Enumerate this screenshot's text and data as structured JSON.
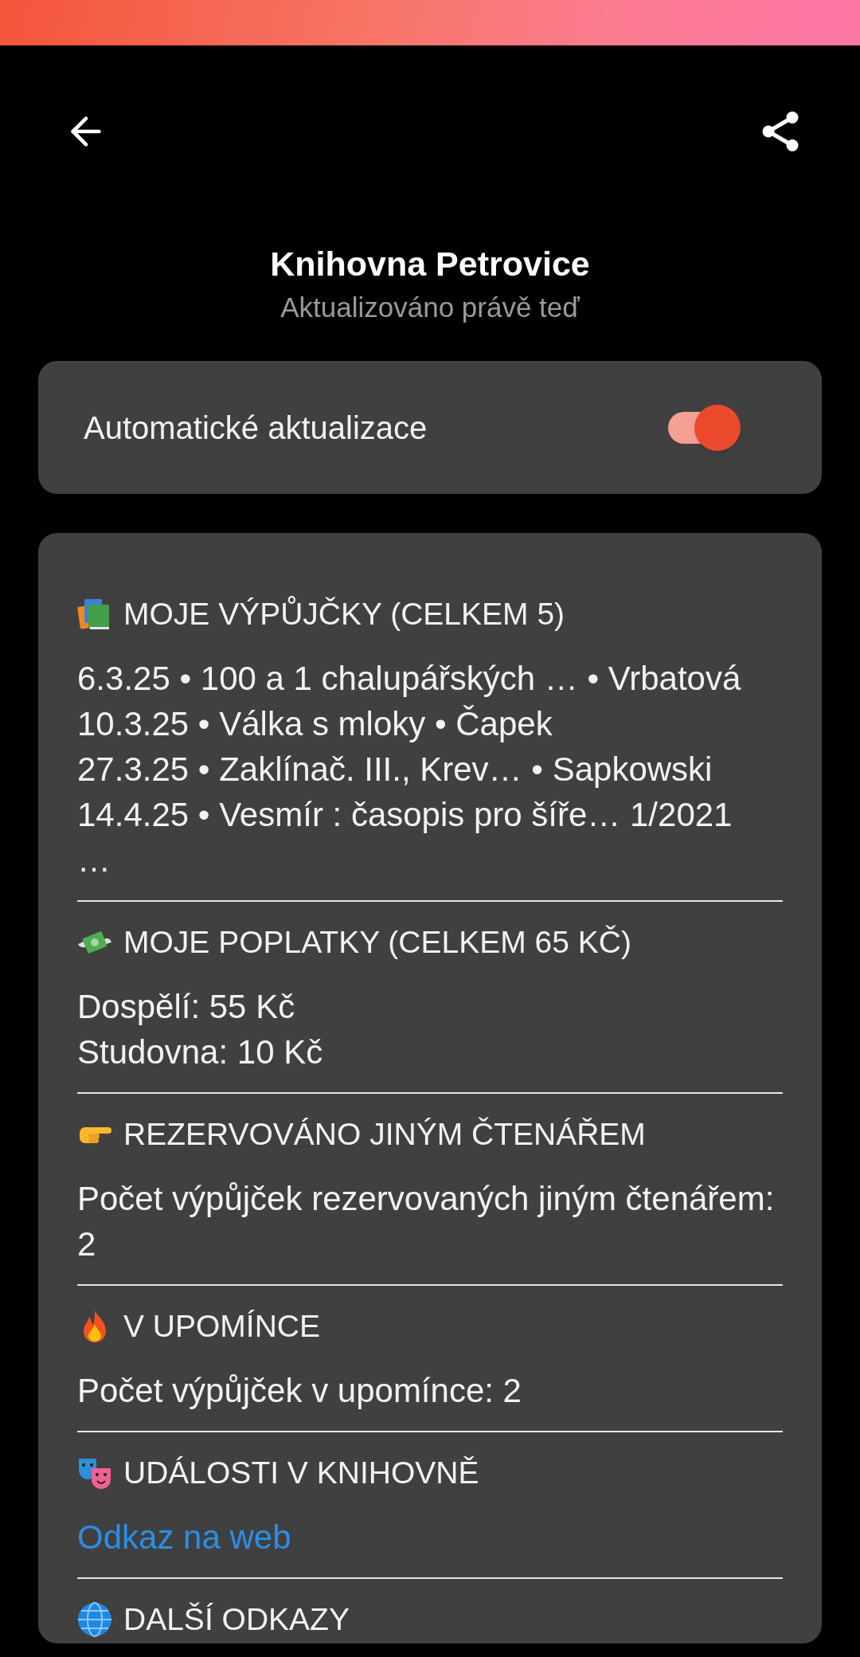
{
  "toolbar": {
    "title": "Knihovna Petrovice",
    "subtitle": "Aktualizováno právě teď"
  },
  "auto_update": {
    "label": "Automatické aktualizace",
    "on": true
  },
  "sections": [
    {
      "title": "MOJE VÝPŮJČKY (CELKEM 5)",
      "lines": [
        {
          "kind": "text",
          "text": "6.3.25 • 100 a 1 chalupářských … • Vrbatová"
        },
        {
          "kind": "text",
          "text": "10.3.25 • Válka s mloky • Čapek"
        },
        {
          "kind": "text",
          "text": "27.3.25 • Zaklínač. III., Krev… • Sapkowski"
        },
        {
          "kind": "text",
          "text": "14.4.25 • Vesmír : časopis pro šíře… 1/2021"
        },
        {
          "kind": "text",
          "text": "…"
        }
      ]
    },
    {
      "title": "MOJE POPLATKY (CELKEM 65 KČ)",
      "lines": [
        {
          "kind": "text",
          "text": "Dospělí: 55 Kč"
        },
        {
          "kind": "text",
          "text": "Studovna: 10 Kč"
        }
      ]
    },
    {
      "title": "REZERVOVÁNO JINÝM ČTENÁŘEM",
      "lines": [
        {
          "kind": "text",
          "text": "Počet výpůjček rezervovaných jiným čtenářem: 2"
        }
      ]
    },
    {
      "title": "V UPOMÍNCE",
      "lines": [
        {
          "kind": "text",
          "text": "Počet výpůjček v upomínce: 2"
        }
      ]
    },
    {
      "title": "UDÁLOSTI V KNIHOVNĚ",
      "lines": [
        {
          "kind": "link",
          "text": "Odkaz na web"
        }
      ]
    },
    {
      "title": "DALŠÍ ODKAZY"
    }
  ]
}
